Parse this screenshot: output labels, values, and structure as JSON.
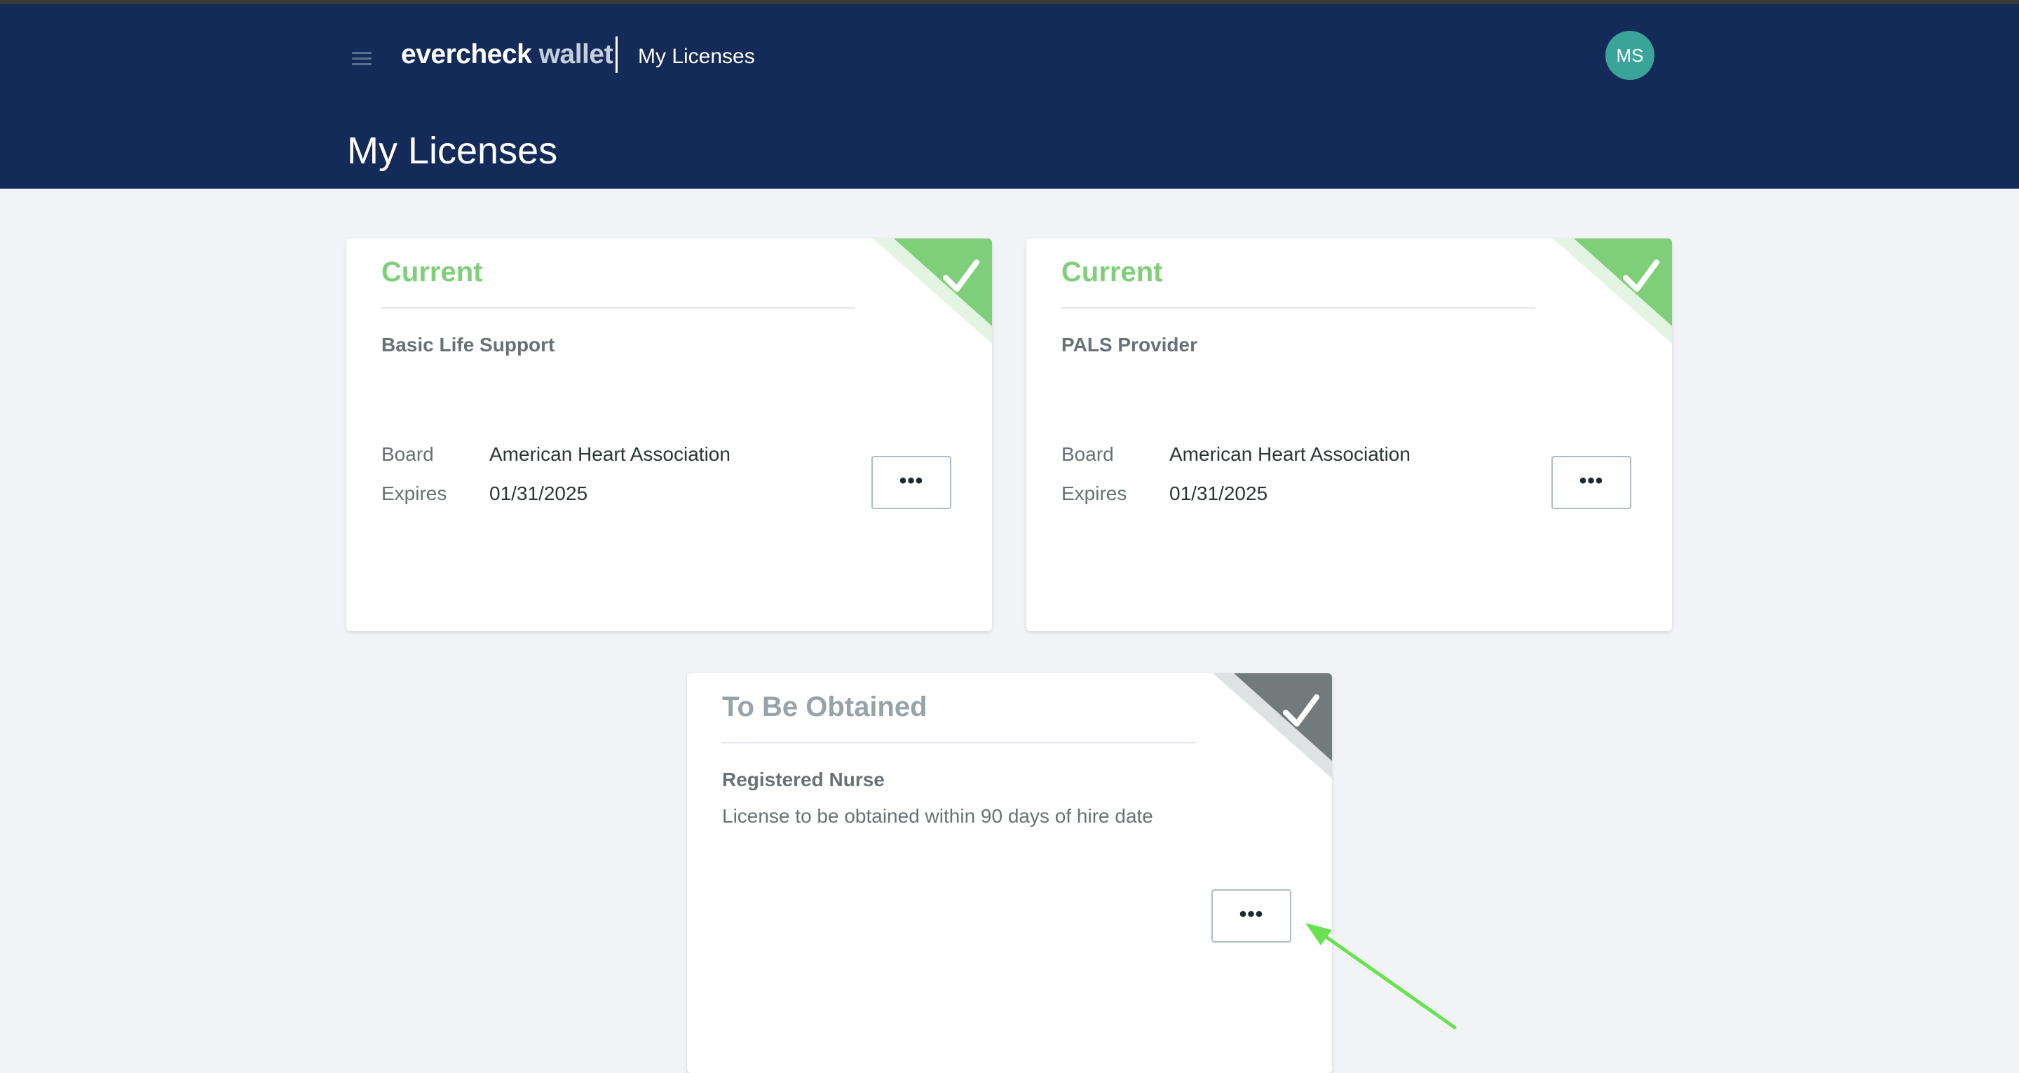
{
  "header": {
    "logo_primary": "evercheck",
    "logo_secondary": "wallet",
    "section": "My Licenses",
    "avatar_initials": "MS"
  },
  "page": {
    "title": "My Licenses"
  },
  "licenses": [
    {
      "status": "Current",
      "name": "Basic Life Support",
      "board_label": "Board",
      "board": "American Heart Association",
      "expires_label": "Expires",
      "expires": "01/31/2025",
      "more_label": "•••"
    },
    {
      "status": "Current",
      "name": "PALS Provider",
      "board_label": "Board",
      "board": "American Heart Association",
      "expires_label": "Expires",
      "expires": "01/31/2025",
      "more_label": "•••"
    },
    {
      "status": "To Be Obtained",
      "name": "Registered Nurse",
      "description": "License to be obtained within 90 days of hire date",
      "more_label": "•••"
    }
  ],
  "colors": {
    "header_bg": "#142b59",
    "page_bg": "#f2f3f6",
    "current": "#7fcf7a",
    "to_be_obtained": "#737a7c",
    "avatar": "#3aa39a",
    "annotation_arrow": "#66e34f"
  },
  "icons": {
    "menu": "hamburger-icon",
    "status": "checkmark-icon"
  }
}
